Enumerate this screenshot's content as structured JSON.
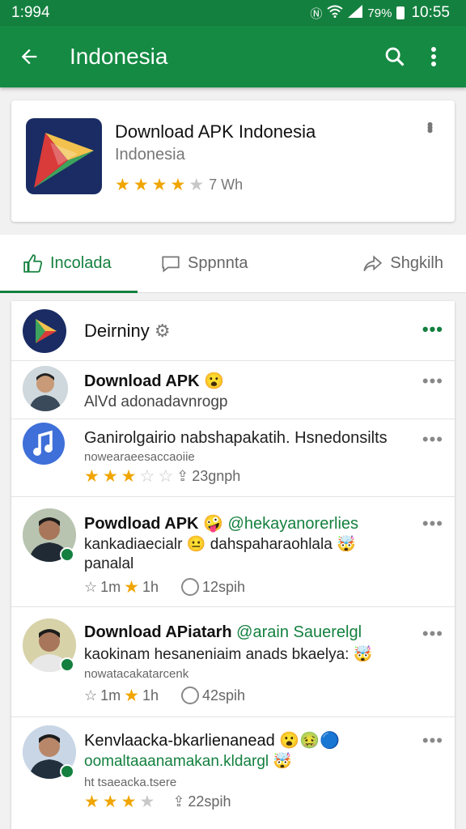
{
  "status_bar": {
    "time_left": "1:994",
    "battery": "79%",
    "time_right": "10:55"
  },
  "app_bar": {
    "title": "Indonesia"
  },
  "app_card": {
    "name": "Download APK Indonesia",
    "subtitle": "Indonesia",
    "rating_text": "7 Wh",
    "rating": 4.5
  },
  "tabs": [
    {
      "label": "Incolada"
    },
    {
      "label": "Sppnnta"
    },
    {
      "label": "Shgkilh"
    }
  ],
  "feed": [
    {
      "name": "Deirniny"
    },
    {
      "name": "Download APK",
      "line": "AlVd adonadavnrogp"
    },
    {
      "name": "Ganirolgairio nabshapakatih. Hsnedonsilts",
      "small": "nowearaeesaccaoiie",
      "rating": 3,
      "meta": "23gnph"
    },
    {
      "name": "Powdload APK",
      "highlight": "@hekayanorerlies",
      "line": "kankadiaecialr",
      "line_b": "dahspaharaohlala",
      "line2": "panalal",
      "meta_a": "1m",
      "meta_b": "1h",
      "meta_c": "12spih"
    },
    {
      "name": "Download APiatarh",
      "highlight": "@arain Sauerelgl",
      "line": "kaokinam hesaneniaim anads bkaelya:",
      "small": "nowatacakatarcenk",
      "meta_a": "1m",
      "meta_b": "1h",
      "meta_c": "42spih"
    },
    {
      "name": "Kenvlaacka-bkarlienanead",
      "line": "oomaltaaanamakan.kldargl",
      "small": "ht tsaeacka.tsere",
      "rating": 3.5,
      "meta": "22spih"
    }
  ]
}
